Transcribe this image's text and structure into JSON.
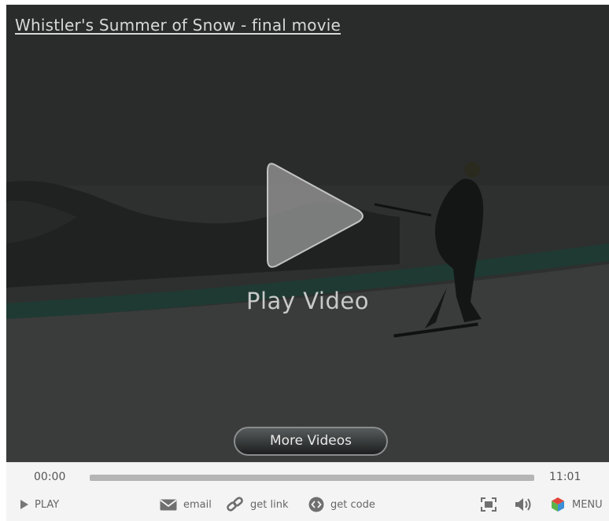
{
  "video": {
    "title": "Whistler's Summer of Snow - final movie",
    "play_label": "Play Video",
    "more_videos_label": "More Videos"
  },
  "controls": {
    "current_time": "00:00",
    "duration": "11:01",
    "progress": 0,
    "play_label": "PLAY",
    "email_label": "email",
    "get_link_label": "get link",
    "get_code_label": "get code",
    "menu_label": "MENU"
  },
  "icons": {
    "play": "play-icon",
    "email": "envelope-icon",
    "link": "chain-link-icon",
    "code": "code-icon",
    "fullscreen": "fullscreen-icon",
    "volume": "speaker-icon",
    "menu": "menu-cube-icon"
  },
  "colors": {
    "overlay": "#2b2e2d",
    "progress_track": "#b5b5b5",
    "control_bar": "#f4f4f4",
    "menu_red": "#e0463a",
    "menu_green": "#5ab54a",
    "menu_blue": "#3b8fd6"
  }
}
